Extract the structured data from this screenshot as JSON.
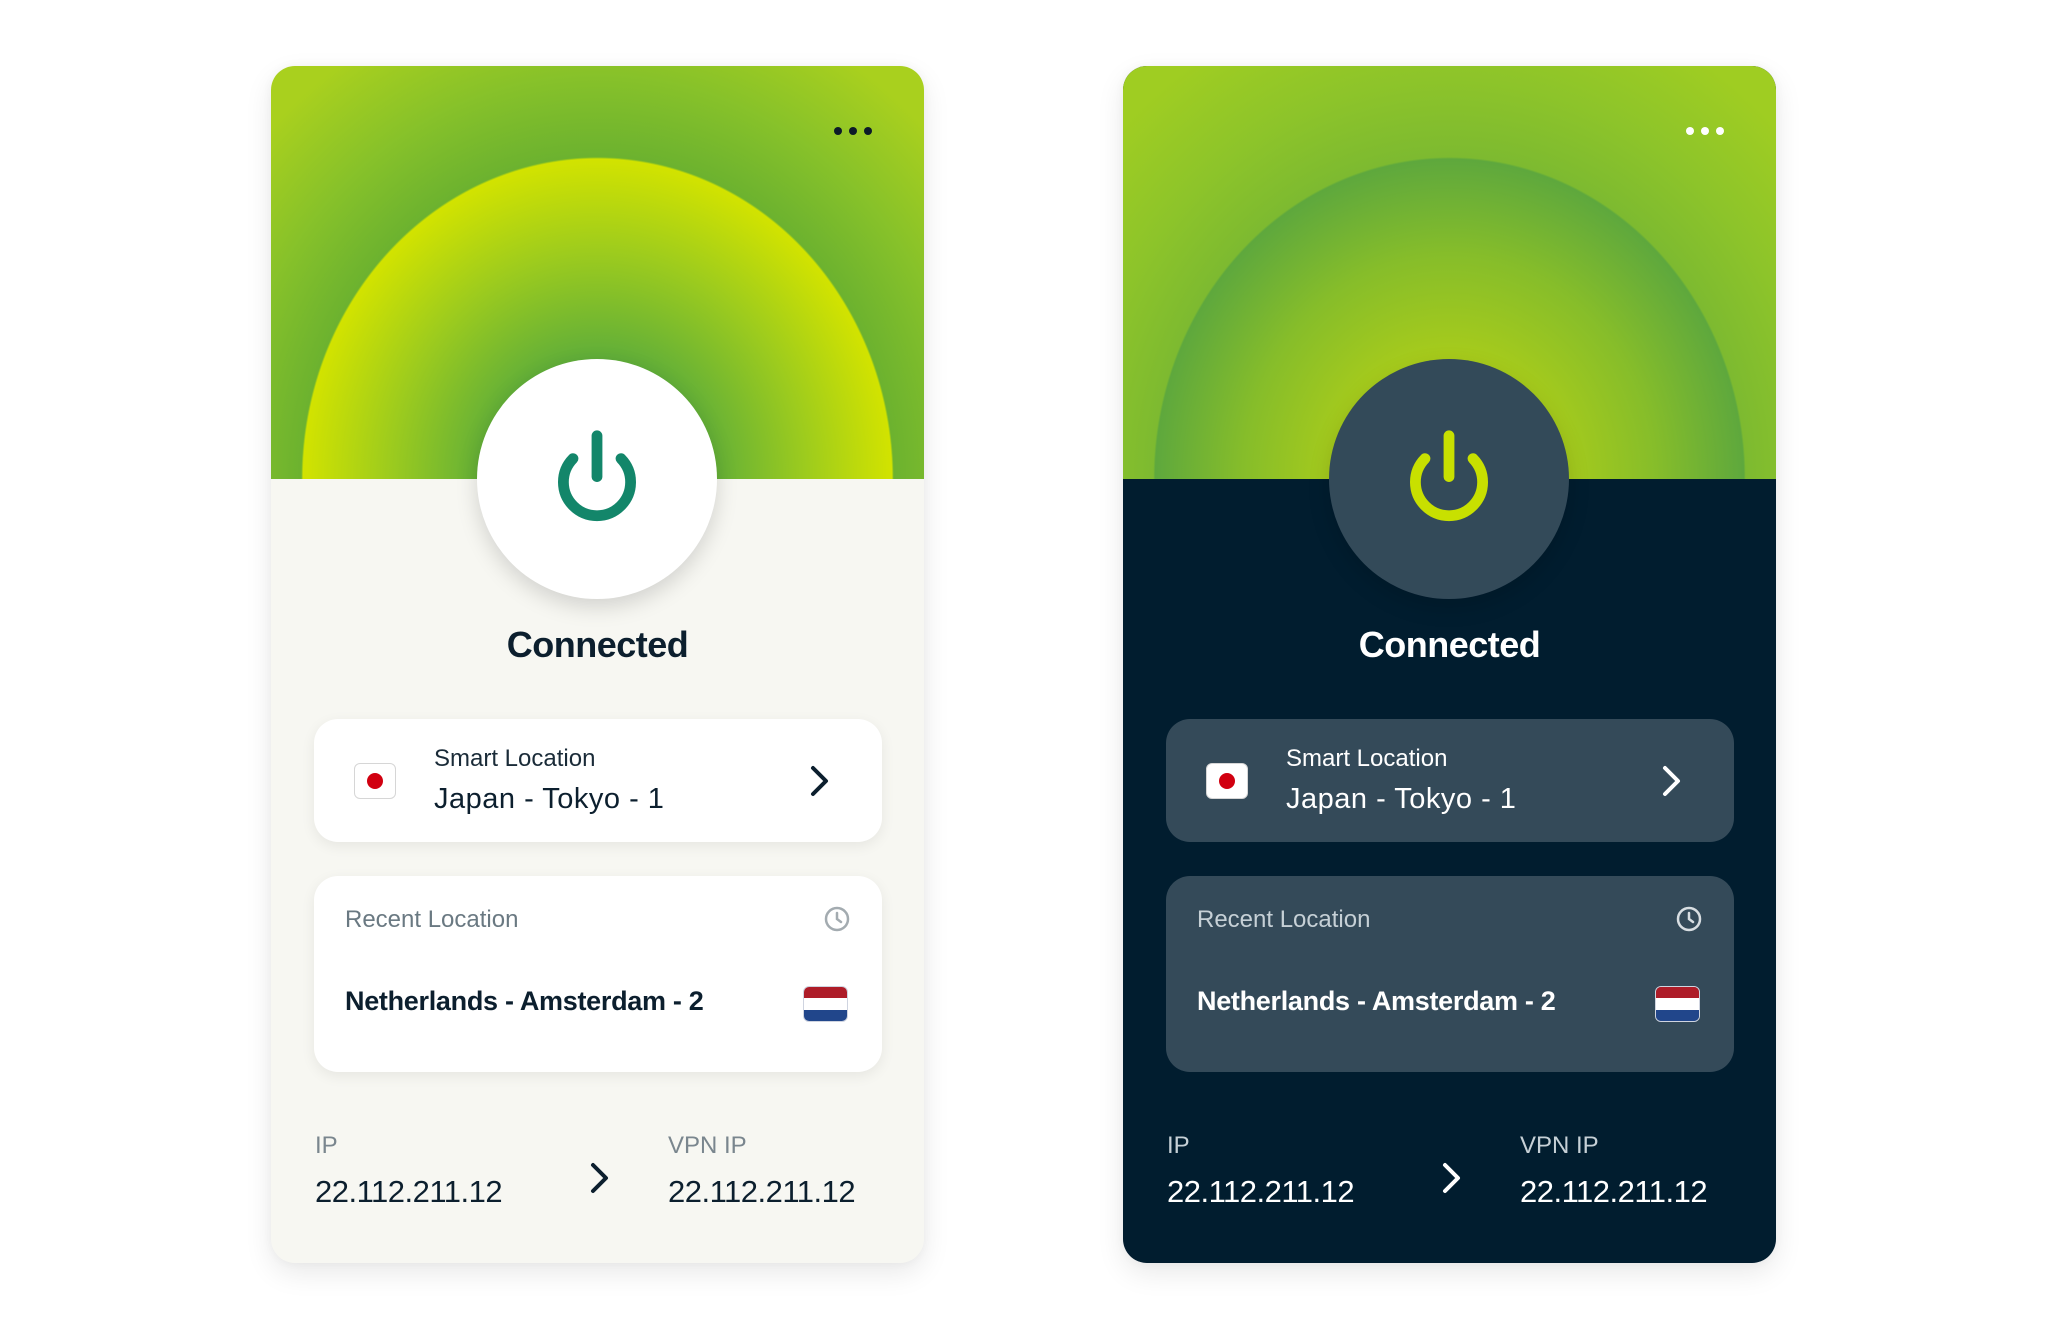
{
  "variants": {
    "light": {
      "theme": "light",
      "menu_icon": "more-horizontal-icon",
      "power_icon": "power-icon",
      "status": "Connected",
      "smart_location": {
        "label": "Smart Location",
        "value": "Japan - Tokyo - 1",
        "flag": "japan-flag"
      },
      "recent_location": {
        "label": "Recent Location",
        "value": "Netherlands - Amsterdam - 2",
        "flag": "netherlands-flag",
        "icon": "clock-icon"
      },
      "ip": {
        "label": "IP",
        "value": "22.112.211.12"
      },
      "vpn_ip": {
        "label": "VPN IP",
        "value": "22.112.211.12"
      }
    },
    "dark": {
      "theme": "dark",
      "menu_icon": "more-horizontal-icon",
      "power_icon": "power-icon",
      "status": "Connected",
      "smart_location": {
        "label": "Smart Location",
        "value": "Japan - Tokyo - 1",
        "flag": "japan-flag"
      },
      "recent_location": {
        "label": "Recent Location",
        "value": "Netherlands - Amsterdam - 2",
        "flag": "netherlands-flag",
        "icon": "clock-icon"
      },
      "ip": {
        "label": "IP",
        "value": "22.112.211.12"
      },
      "vpn_ip": {
        "label": "VPN IP",
        "value": "22.112.211.12"
      }
    }
  },
  "colors": {
    "power_light": "#13866a",
    "power_dark": "#c8e000",
    "dark_bg": "#011d2f",
    "dark_card": "#344a59",
    "light_bg": "#f7f7f2",
    "flag_red": "#d10010",
    "nl_red": "#ae1c28",
    "nl_blue": "#21468b"
  }
}
